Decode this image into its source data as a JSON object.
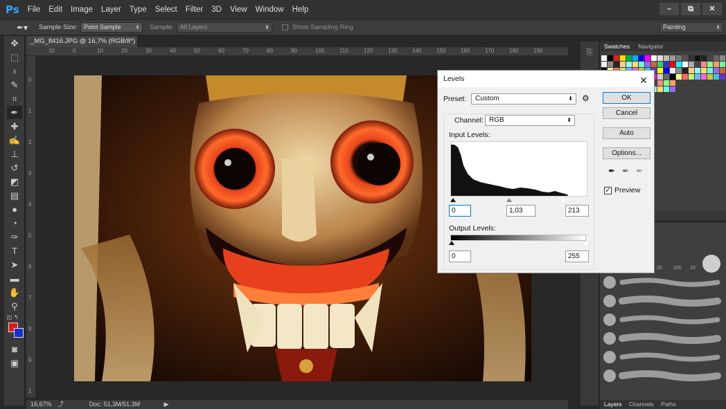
{
  "app": {
    "logo": "Ps"
  },
  "menu": [
    "File",
    "Edit",
    "Image",
    "Layer",
    "Type",
    "Select",
    "Filter",
    "3D",
    "View",
    "Window",
    "Help"
  ],
  "window_controls": {
    "minimize": "–",
    "restore": "⧉",
    "close": "✕"
  },
  "options_bar": {
    "sample_size_label": "Sample Size:",
    "sample_size_value": "Point Sample",
    "sample_label": "Sample:",
    "sample_value": "All Layers",
    "show_ring_label": "Show Sampling Ring",
    "workspace": "Painting"
  },
  "document": {
    "tab_title": "_MG_8416.JPG @ 16,7% (RGB/8*)",
    "tab_close": "×",
    "ruler_h": [
      "10",
      "0",
      "10",
      "20",
      "30",
      "40",
      "50",
      "60",
      "70",
      "80",
      "90",
      "100",
      "110",
      "120",
      "130",
      "140",
      "150",
      "160",
      "170",
      "180",
      "190"
    ],
    "ruler_v": [
      "0",
      "1",
      "2",
      "3",
      "4",
      "5",
      "6",
      "7",
      "8",
      "9",
      "1"
    ]
  },
  "status": {
    "zoom": "16,67%",
    "doc": "Doc: 51,3M/51,3M"
  },
  "panels": {
    "swatches_tab": "Swatches",
    "navigator_tab": "Navigator",
    "layers_tab": "Layers",
    "channels_tab": "Channels",
    "paths_tab": "Paths",
    "brush_sizes": [
      "25",
      "200",
      "15"
    ]
  },
  "levels": {
    "title": "Levels",
    "close": "✕",
    "preset_label": "Preset:",
    "preset_value": "Custom",
    "channel_label": "Channel:",
    "channel_value": "RGB",
    "input_levels_label": "Input Levels:",
    "input_black": "0",
    "input_gamma": "1,03",
    "input_white": "213",
    "output_levels_label": "Output Levels:",
    "output_black": "0",
    "output_white": "255",
    "ok": "OK",
    "cancel": "Cancel",
    "auto": "Auto",
    "options": "Options...",
    "preview_label": "Preview",
    "preview_checked": true
  },
  "colors": {
    "foreground": "#e01b1b",
    "background": "#1a2fd6",
    "ps_blue": "#31a8ff",
    "default_button_border": "#0078d7"
  }
}
